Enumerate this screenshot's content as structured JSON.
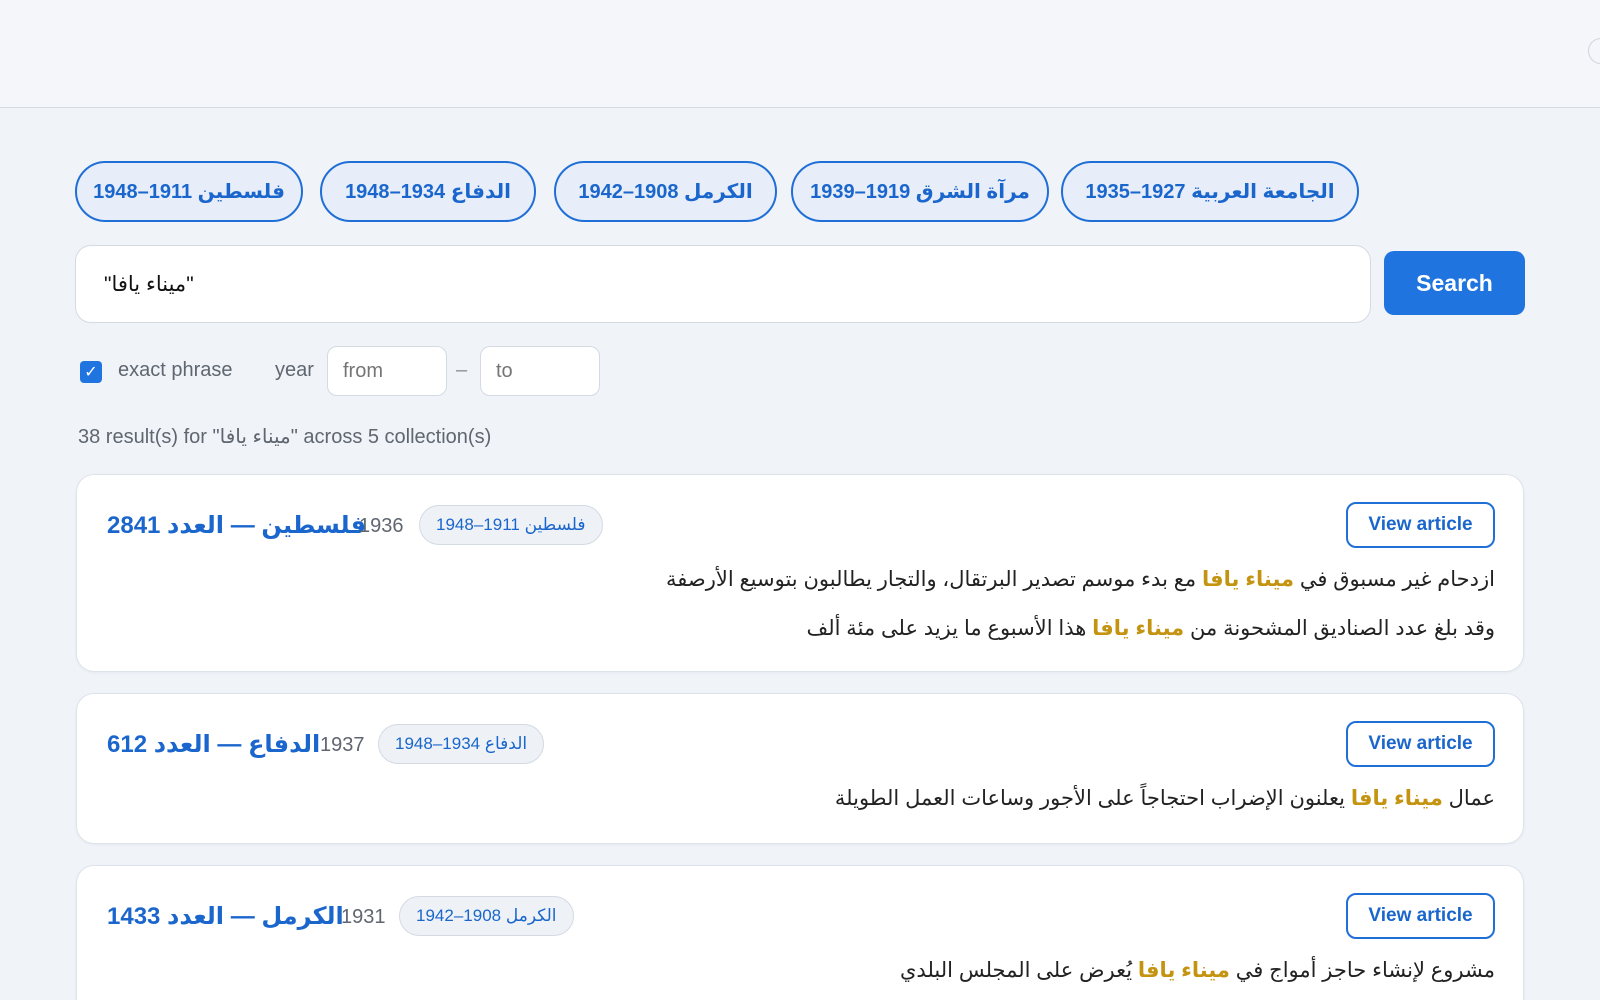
{
  "collections": [
    {
      "label": "فلسطين 1911–1948"
    },
    {
      "label": "الدفاع 1934–1948"
    },
    {
      "label": "الكرمل 1908–1942"
    },
    {
      "label": "مرآة الشرق 1919–1939"
    },
    {
      "label": "الجامعة العربية 1927–1935"
    }
  ],
  "search": {
    "query": "\"ميناء يافا\"",
    "button_label": "Search"
  },
  "options": {
    "exact_phrase_checked": true,
    "exact_phrase_label": "exact phrase",
    "year_label": "year",
    "from_placeholder": "from",
    "to_placeholder": "to",
    "range_dash": "–"
  },
  "summary": "38 result(s) for \"ميناء يافا\" across 5 collection(s)",
  "results": [
    {
      "title": "فلسطين — العدد 2841",
      "year": "1936",
      "collection": "فلسطين 1911–1948",
      "view_label": "View article",
      "snippets": [
        {
          "before": "ازدحام غير مسبوق في ",
          "match": "ميناء يافا",
          "after": " مع بدء موسم تصدير البرتقال، والتجار يطالبون بتوسيع الأرصفة"
        },
        {
          "before": "وقد بلغ عدد الصناديق المشحونة من ",
          "match": "ميناء يافا",
          "after": " هذا الأسبوع ما يزيد على مئة ألف"
        }
      ]
    },
    {
      "title": "الدفاع — العدد 612",
      "year": "1937",
      "collection": "الدفاع 1934–1948",
      "view_label": "View article",
      "snippets": [
        {
          "before": "عمال ",
          "match": "ميناء يافا",
          "after": " يعلنون الإضراب احتجاجاً على الأجور وساعات العمل الطويلة"
        }
      ]
    },
    {
      "title": "الكرمل — العدد 1433",
      "year": "1931",
      "collection": "الكرمل 1908–1942",
      "view_label": "View article",
      "snippets": [
        {
          "before": "مشروع لإنشاء حاجز أمواج في ",
          "match": "ميناء يافا",
          "after": " يُعرض على المجلس البلدي"
        }
      ]
    }
  ],
  "colors": {
    "accent": "#1f74e0",
    "highlight": "#c49410",
    "background": "#f0f4f9"
  }
}
